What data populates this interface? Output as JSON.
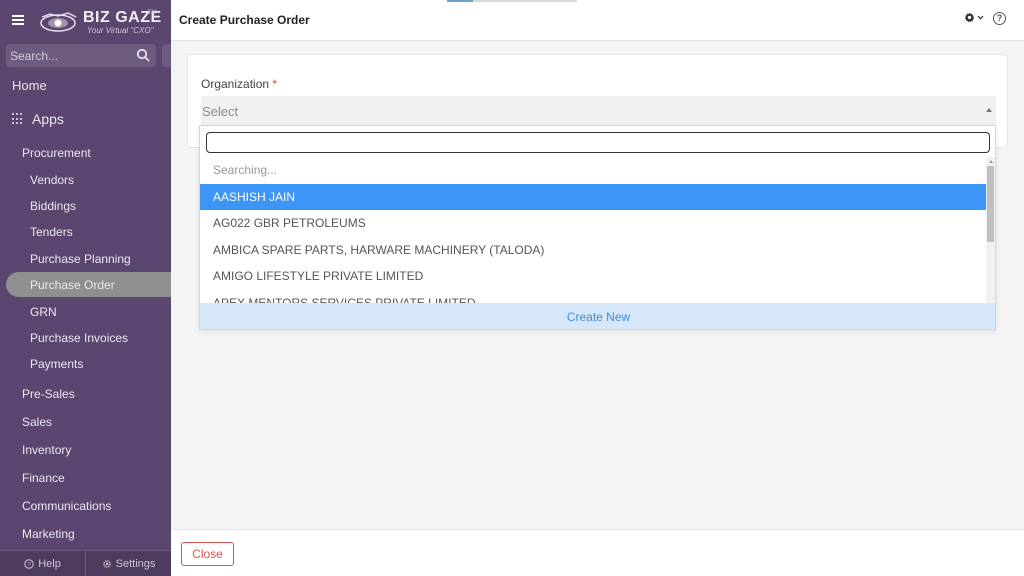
{
  "brand": {
    "name": "BIZ GAZE",
    "tagline": "Your Virtual \"CXO\"",
    "tm": "TM"
  },
  "sidebar": {
    "search_placeholder": "Search...",
    "home": "Home",
    "apps": "Apps",
    "procurement": "Procurement",
    "procurement_items": [
      "Vendors",
      "Biddings",
      "Tenders",
      "Purchase Planning",
      "Purchase Order",
      "GRN",
      "Purchase Invoices",
      "Payments"
    ],
    "active_item": "Purchase Order",
    "sections": [
      "Pre-Sales",
      "Sales",
      "Inventory",
      "Finance",
      "Communications",
      "Marketing"
    ],
    "help": "Help",
    "settings": "Settings"
  },
  "header": {
    "title": "Create Purchase Order"
  },
  "form": {
    "org_label": "Organization",
    "required_mark": "*",
    "select_value": "Select"
  },
  "dropdown": {
    "search_value": "",
    "searching_text": "Searching...",
    "options": [
      "AASHISH JAIN",
      "AG022 GBR PETROLEUMS",
      "AMBICA SPARE PARTS, HARWARE MACHINERY (TALODA)",
      "AMIGO LIFESTYLE PRIVATE LIMITED",
      "APEX MENTORS SERVICES PRIVATE LIMITED"
    ],
    "selected_option": "AASHISH JAIN",
    "create_new": "Create New"
  },
  "footer": {
    "close_label": "Close"
  },
  "colors": {
    "sidebar_bg": "#5a466e",
    "active_item_bg": "#8f8f8f",
    "selected_option_bg": "#3d96f5",
    "create_new_bg": "#d5e7f8",
    "close_accent": "#d9534f",
    "required_red": "#e03030"
  }
}
